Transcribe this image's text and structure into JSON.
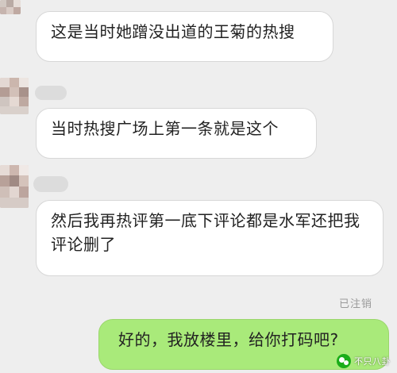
{
  "messages": [
    {
      "side": "left",
      "text": "这是当时她蹭没出道的王菊的热搜"
    },
    {
      "side": "left",
      "text": "当时热搜广场上第一条就是这个"
    },
    {
      "side": "left",
      "text": "然后我再热评第一底下评论都是水军还把我评论删了"
    },
    {
      "side": "right",
      "text": "好的，我放楼里，给你打码吧?"
    }
  ],
  "status": {
    "cancelled_label": "已注销"
  },
  "watermark": {
    "text": "不只八卦",
    "icon": "wechat-icon"
  },
  "colors": {
    "background": "#eeeeee",
    "bubble_left": "#ffffff",
    "bubble_right": "#a9ea7a",
    "status_text": "#9a9a9a",
    "watermark_icon": "#1aad19"
  }
}
